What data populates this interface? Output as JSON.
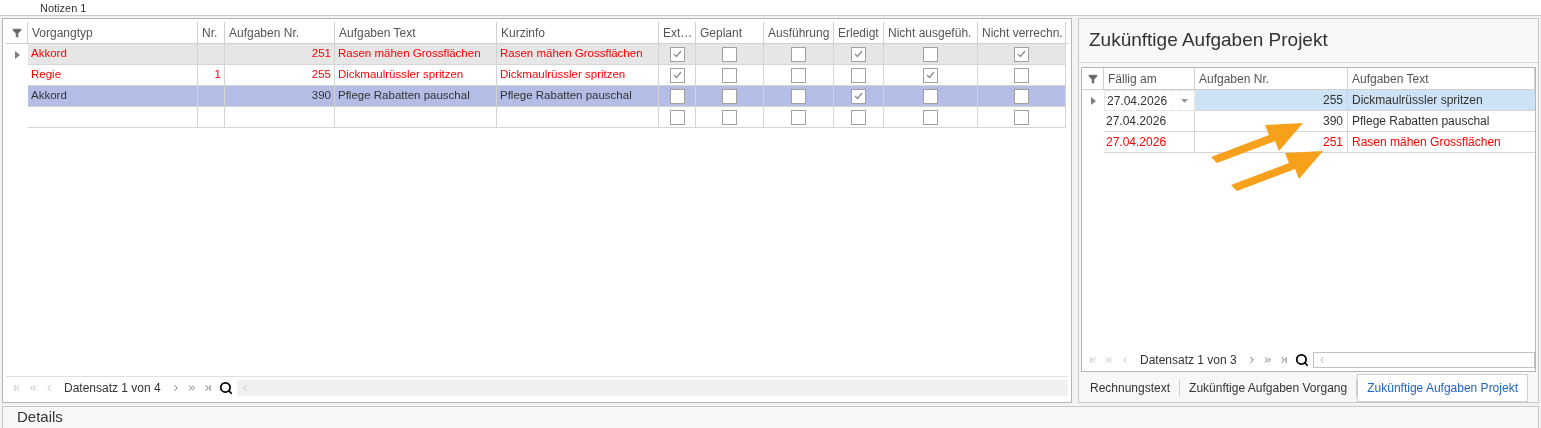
{
  "top_strip": {
    "label": "Notizen 1"
  },
  "tasks_grid": {
    "columns": [
      "Vorgangtyp",
      "Nr.",
      "Aufgaben Nr.",
      "Aufgaben Text",
      "Kurzinfo",
      "Ext…",
      "Geplant",
      "Ausführung",
      "Erledigt",
      "Nicht ausgefüh.",
      "Nicht verrechn."
    ],
    "rows": [
      {
        "vorgangtyp": "Akkord",
        "aufgaben_nr": "251",
        "aufgaben_text": "Rasen mähen Grossflächen",
        "kurzinfo": "Rasen mähen Grossflächen",
        "checks": [
          true,
          false,
          false,
          true,
          false,
          true
        ],
        "color": "#ff0000",
        "focused": true,
        "selected": false
      },
      {
        "vorgangtyp": "Regie",
        "nr": "1",
        "aufgaben_nr": "255",
        "aufgaben_text": "Dickmaulrüssler spritzen",
        "kurzinfo": "Dickmaulrüssler spritzen",
        "checks": [
          true,
          false,
          false,
          false,
          true,
          false
        ],
        "color": "#ff0000",
        "focused": false,
        "selected": false
      },
      {
        "vorgangtyp": "Akkord",
        "aufgaben_nr": "390",
        "aufgaben_text": "Pflege Rabatten pauschal",
        "kurzinfo": "Pflege Rabatten pauschal",
        "checks": [
          false,
          false,
          false,
          true,
          false,
          false
        ],
        "color": "#333333",
        "focused": false,
        "selected": true
      },
      {
        "checks": [
          false,
          false,
          false,
          false,
          false,
          false
        ],
        "focused": false,
        "selected": false
      }
    ],
    "pager": {
      "label": "Datensatz 1 von 4"
    }
  },
  "future_tasks": {
    "title": "Zukünftige Aufgaben Projekt",
    "columns": [
      "Fällig am",
      "Aufgaben Nr.",
      "Aufgaben Text"
    ],
    "rows": [
      {
        "faellig_am": "27.04.2026",
        "aufgaben_nr": "255",
        "aufgaben_text": "Dickmaulrüssler spritzen",
        "color": "#333333",
        "focused": true
      },
      {
        "faellig_am": "27.04.2026",
        "aufgaben_nr": "390",
        "aufgaben_text": "Pflege Rabatten pauschal",
        "color": "#333333",
        "focused": false
      },
      {
        "faellig_am": "27.04.2026",
        "aufgaben_nr": "251",
        "aufgaben_text": "Rasen mähen Grossflächen",
        "color": "#ff0000",
        "focused": false
      }
    ],
    "pager": {
      "label": "Datensatz 1 von 3"
    }
  },
  "tabs": [
    {
      "label": "Rechnungstext",
      "selected": false
    },
    {
      "label": "Zukünftige Aufgaben Vorgang",
      "selected": false
    },
    {
      "label": "Zukünftige Aufgaben Projekt",
      "selected": true
    }
  ],
  "details": {
    "title": "Details"
  }
}
